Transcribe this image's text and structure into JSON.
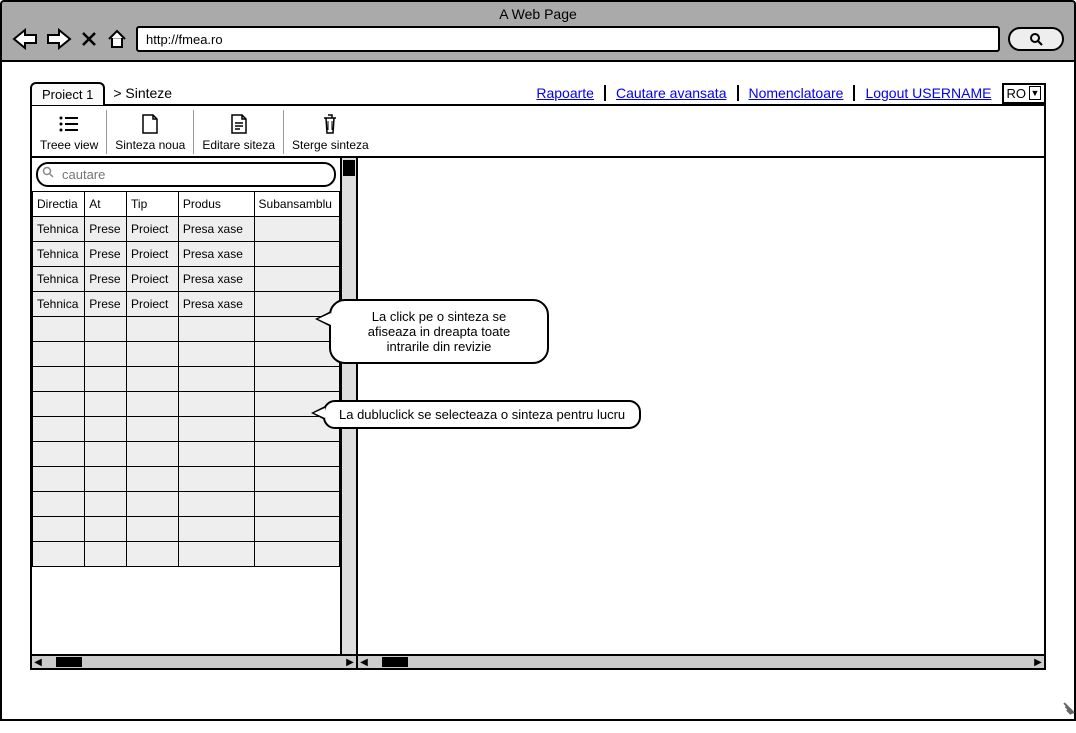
{
  "browser": {
    "title": "A Web Page",
    "url": "http://fmea.ro"
  },
  "tab": {
    "label": "Proiect 1"
  },
  "breadcrumb": {
    "arrow": ">",
    "current": "Sinteze"
  },
  "header_links": {
    "rapoarte": "Rapoarte",
    "cautare_avansata": "Cautare avansata",
    "nomenclatoare": "Nomenclatoare",
    "logout": "Logout USERNAME"
  },
  "lang": {
    "value": "RO"
  },
  "toolbar": {
    "tree_view": "Treee view",
    "sinteza_noua": "Sinteza noua",
    "editare_sinteza": "Editare siteza",
    "sterge_sinteza": "Sterge sinteza"
  },
  "search": {
    "placeholder": "cautare"
  },
  "table": {
    "headers": {
      "directia": "Directia",
      "at": "At",
      "tip": "Tip",
      "produs": "Produs",
      "subansamblu": "Subansamblu"
    },
    "rows": [
      {
        "directia": "Tehnica",
        "at": "Prese",
        "tip": "Proiect",
        "produs": "Presa xase",
        "subansamblu": ""
      },
      {
        "directia": "Tehnica",
        "at": "Prese",
        "tip": "Proiect",
        "produs": "Presa xase",
        "subansamblu": ""
      },
      {
        "directia": "Tehnica",
        "at": "Prese",
        "tip": "Proiect",
        "produs": "Presa xase",
        "subansamblu": ""
      },
      {
        "directia": "Tehnica",
        "at": "Prese",
        "tip": "Proiect",
        "produs": "Presa xase",
        "subansamblu": ""
      }
    ],
    "empty_row_count": 10
  },
  "callouts": {
    "click": "La click pe o sinteza se afiseaza in dreapta toate intrarile din revizie",
    "dblclick": "La dubluclick se selecteaza o sinteza pentru lucru"
  }
}
